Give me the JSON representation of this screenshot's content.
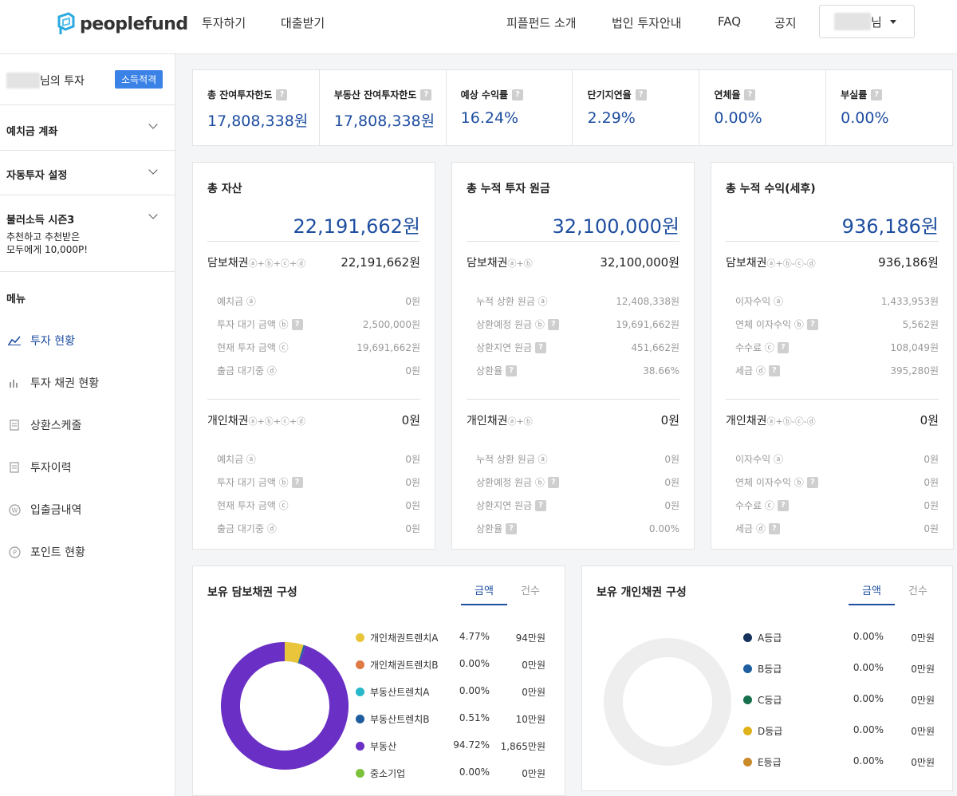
{
  "header": {
    "logo_text": "peoplefund",
    "nav_left": [
      "투자하기",
      "대출받기"
    ],
    "nav_right": [
      "피플펀드 소개",
      "법인 투자안내",
      "FAQ",
      "공지"
    ],
    "user_suffix": "님"
  },
  "sidebar": {
    "name_suffix": "님의 투자",
    "badge": "소득적격",
    "sections": [
      {
        "title": "예치금 계좌"
      },
      {
        "title": "자동투자 설정"
      },
      {
        "title": "불러소득 시즌3",
        "desc1": "추천하고 추천받은",
        "desc2": "모두에게 10,000P!"
      }
    ],
    "menu_label": "메뉴",
    "menu": [
      {
        "label": "투자 현황",
        "icon": "line-chart-icon"
      },
      {
        "label": "투자 채권 현황",
        "icon": "bar-chart-icon"
      },
      {
        "label": "상환스케줄",
        "icon": "document-icon"
      },
      {
        "label": "투자이력",
        "icon": "document-icon"
      },
      {
        "label": "입출금내역",
        "icon": "won-icon"
      },
      {
        "label": "포인트 현황",
        "icon": "point-icon"
      }
    ]
  },
  "stats": [
    {
      "label": "총 잔여투자한도",
      "value": "17,808,338원"
    },
    {
      "label": "부동산 잔여투자한도",
      "value": "17,808,338원"
    },
    {
      "label": "예상 수익률",
      "value": "16.24%"
    },
    {
      "label": "단기지연율",
      "value": "2.29%"
    },
    {
      "label": "연체율",
      "value": "0.00%"
    },
    {
      "label": "부실률",
      "value": "0.00%"
    }
  ],
  "assets": [
    {
      "title": "총 자산",
      "total": "22,191,662원",
      "g1": {
        "label": "담보채권",
        "formula": "ⓐ+ⓑ+ⓒ+ⓓ",
        "value": "22,191,662원",
        "rows": [
          {
            "label": "예치금 ⓐ",
            "q": false,
            "value": "0원"
          },
          {
            "label": "투자 대기 금액 ⓑ",
            "q": true,
            "value": "2,500,000원"
          },
          {
            "label": "현재 투자 금액 ⓒ",
            "q": false,
            "value": "19,691,662원"
          },
          {
            "label": "출금 대기중 ⓓ",
            "q": false,
            "value": "0원"
          }
        ]
      },
      "g2": {
        "label": "개인채권",
        "formula": "ⓐ+ⓑ+ⓒ+ⓓ",
        "value": "0원",
        "rows": [
          {
            "label": "예치금 ⓐ",
            "q": false,
            "value": "0원"
          },
          {
            "label": "투자 대기 금액 ⓑ",
            "q": true,
            "value": "0원"
          },
          {
            "label": "현재 투자 금액 ⓒ",
            "q": false,
            "value": "0원"
          },
          {
            "label": "출금 대기중 ⓓ",
            "q": false,
            "value": "0원"
          }
        ]
      }
    },
    {
      "title": "총 누적 투자 원금",
      "total": "32,100,000원",
      "g1": {
        "label": "담보채권",
        "formula": "ⓐ+ⓑ",
        "value": "32,100,000원",
        "rows": [
          {
            "label": "누적 상환 원금 ⓐ",
            "q": false,
            "value": "12,408,338원"
          },
          {
            "label": "상환예정 원금 ⓑ",
            "q": true,
            "value": "19,691,662원"
          },
          {
            "label": "상환지연 원금",
            "q": true,
            "value": "451,662원"
          },
          {
            "label": "상환율",
            "q": true,
            "value": "38.66%"
          }
        ]
      },
      "g2": {
        "label": "개인채권",
        "formula": "ⓐ+ⓑ",
        "value": "0원",
        "rows": [
          {
            "label": "누적 상환 원금 ⓐ",
            "q": false,
            "value": "0원"
          },
          {
            "label": "상환예정 원금 ⓑ",
            "q": true,
            "value": "0원"
          },
          {
            "label": "상환지연 원금",
            "q": true,
            "value": "0원"
          },
          {
            "label": "상환율",
            "q": true,
            "value": "0.00%"
          }
        ]
      }
    },
    {
      "title": "총 누적 수익(세후)",
      "total": "936,186원",
      "g1": {
        "label": "담보채권",
        "formula": "ⓐ+ⓑ-ⓒ-ⓓ",
        "value": "936,186원",
        "rows": [
          {
            "label": "이자수익 ⓐ",
            "q": false,
            "value": "1,433,953원"
          },
          {
            "label": "연체 이자수익 ⓑ",
            "q": true,
            "value": "5,562원"
          },
          {
            "label": "수수료 ⓒ",
            "q": true,
            "value": "108,049원"
          },
          {
            "label": "세금 ⓓ",
            "q": true,
            "value": "395,280원"
          }
        ]
      },
      "g2": {
        "label": "개인채권",
        "formula": "ⓐ+ⓑ-ⓒ-ⓓ",
        "value": "0원",
        "rows": [
          {
            "label": "이자수익 ⓐ",
            "q": false,
            "value": "0원"
          },
          {
            "label": "연체 이자수익 ⓑ",
            "q": true,
            "value": "0원"
          },
          {
            "label": "수수료 ⓒ",
            "q": true,
            "value": "0원"
          },
          {
            "label": "세금 ⓓ",
            "q": true,
            "value": "0원"
          }
        ]
      }
    }
  ],
  "secured": {
    "title": "보유 담보채권 구성",
    "tabs": [
      "금액",
      "건수"
    ],
    "items": [
      {
        "name": "개인채권트렌치A",
        "pct": "4.77%",
        "amount": "94만원",
        "color": "#e8c53a",
        "value": 4.77
      },
      {
        "name": "개인채권트렌치B",
        "pct": "0.00%",
        "amount": "0만원",
        "color": "#e07a45",
        "value": 0
      },
      {
        "name": "부동산트렌치A",
        "pct": "0.00%",
        "amount": "0만원",
        "color": "#27b8c9",
        "value": 0
      },
      {
        "name": "부동산트렌치B",
        "pct": "0.51%",
        "amount": "10만원",
        "color": "#1f5e9e",
        "value": 0.51
      },
      {
        "name": "부동산",
        "pct": "94.72%",
        "amount": "1,865만원",
        "color": "#6a2fc4",
        "value": 94.72
      },
      {
        "name": "중소기업",
        "pct": "0.00%",
        "amount": "0만원",
        "color": "#7cc13a",
        "value": 0
      }
    ]
  },
  "personal": {
    "title": "보유 개인채권 구성",
    "tabs": [
      "금액",
      "건수"
    ],
    "items": [
      {
        "name": "A등급",
        "pct": "0.00%",
        "amount": "0만원",
        "color": "#17325c"
      },
      {
        "name": "B등급",
        "pct": "0.00%",
        "amount": "0만원",
        "color": "#1e5fa0"
      },
      {
        "name": "C등급",
        "pct": "0.00%",
        "amount": "0만원",
        "color": "#16704e"
      },
      {
        "name": "D등급",
        "pct": "0.00%",
        "amount": "0만원",
        "color": "#e0b21a"
      },
      {
        "name": "E등급",
        "pct": "0.00%",
        "amount": "0만원",
        "color": "#c98a2a"
      }
    ]
  }
}
